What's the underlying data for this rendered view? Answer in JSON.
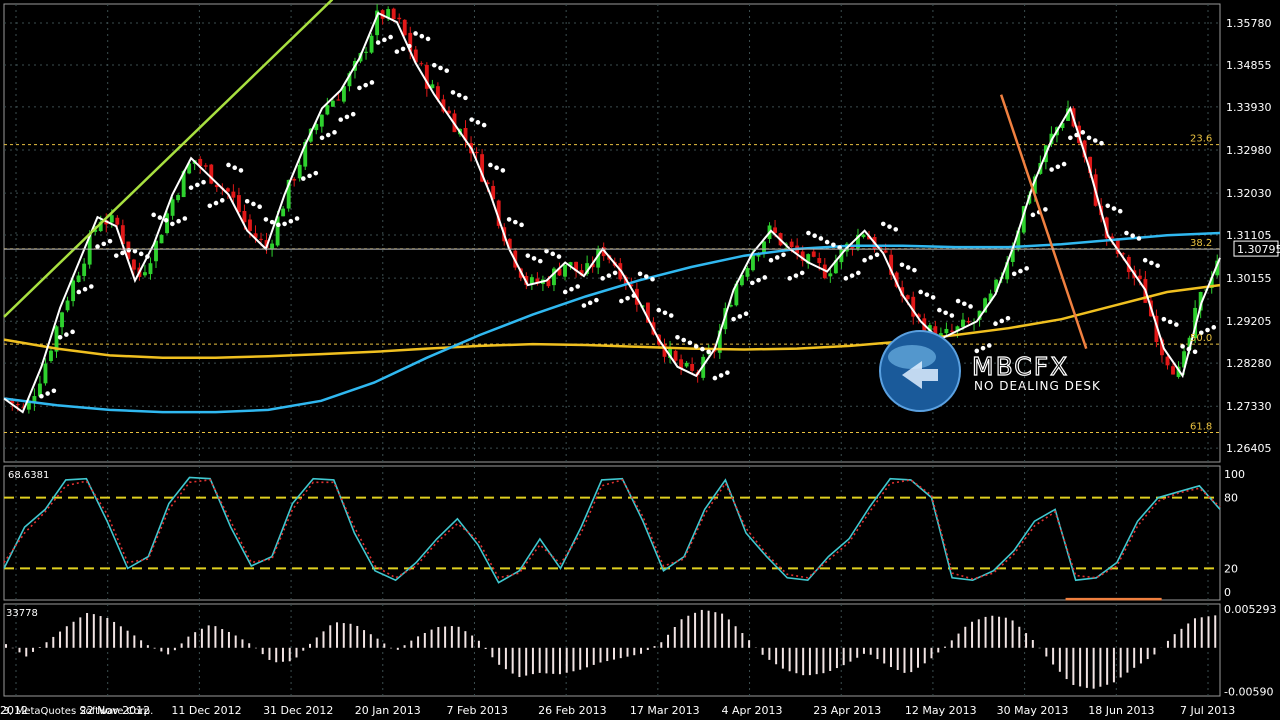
{
  "chart_data": [
    {
      "type": "candlestick",
      "symbol_price_tag": "1.30795",
      "price_ticks": [
        "1.35780",
        "1.34855",
        "1.33930",
        "1.32980",
        "1.32030",
        "1.31105",
        "1.30155",
        "1.29205",
        "1.28280",
        "1.27330",
        "1.26405"
      ],
      "ylim": [
        1.261,
        1.362
      ],
      "x_labels": [
        "2012",
        "22 Nov 2012",
        "11 Dec 2012",
        "31 Dec 2012",
        "20 Jan 2013",
        "7 Feb 2013",
        "26 Feb 2013",
        "17 Mar 2013",
        "4 Apr 2013",
        "23 Apr 2013",
        "12 May 2013",
        "30 May 2013",
        "18 Jun 2013",
        "7 Jul 2013"
      ],
      "close_path": [
        1.275,
        1.272,
        1.282,
        1.295,
        1.305,
        1.315,
        1.313,
        1.301,
        1.309,
        1.32,
        1.328,
        1.324,
        1.32,
        1.312,
        1.308,
        1.32,
        1.33,
        1.339,
        1.343,
        1.35,
        1.36,
        1.358,
        1.349,
        1.342,
        1.336,
        1.33,
        1.32,
        1.308,
        1.3,
        1.301,
        1.305,
        1.302,
        1.308,
        1.303,
        1.296,
        1.288,
        1.282,
        1.28,
        1.286,
        1.299,
        1.307,
        1.312,
        1.308,
        1.305,
        1.303,
        1.308,
        1.312,
        1.307,
        1.298,
        1.292,
        1.288,
        1.29,
        1.292,
        1.298,
        1.309,
        1.322,
        1.332,
        1.339,
        1.326,
        1.311,
        1.305,
        1.299,
        1.286,
        1.28,
        1.296,
        1.306
      ],
      "moving_averages": [
        {
          "name": "slow",
          "color": "#f0c020",
          "values": [
            1.288,
            1.286,
            1.2845,
            1.284,
            1.284,
            1.2843,
            1.2848,
            1.2853,
            1.286,
            1.2866,
            1.287,
            1.2868,
            1.2864,
            1.286,
            1.2858,
            1.286,
            1.2866,
            1.2876,
            1.289,
            1.2905,
            1.2925,
            1.2955,
            1.2985,
            1.3
          ]
        },
        {
          "name": "mid",
          "color": "#30b8f0",
          "values": [
            1.275,
            1.2735,
            1.2725,
            1.272,
            1.272,
            1.2725,
            1.2745,
            1.2785,
            1.284,
            1.289,
            1.2935,
            1.2975,
            1.301,
            1.304,
            1.3065,
            1.308,
            1.3087,
            1.3087,
            1.3084,
            1.3084,
            1.309,
            1.31,
            1.311,
            1.3115
          ]
        }
      ],
      "trend_lines": [
        {
          "color": "#a8e040",
          "from": [
            0,
            1.293
          ],
          "to": [
            0.27,
            1.363
          ]
        },
        {
          "color": "#f08040",
          "from": [
            0.82,
            1.342
          ],
          "to": [
            0.89,
            1.286
          ]
        }
      ],
      "fibonacci": [
        {
          "label": "23.6",
          "price": 1.331
        },
        {
          "label": "38.2",
          "price": 1.308
        },
        {
          "label": "50.0",
          "price": 1.287
        },
        {
          "label": "61.8",
          "price": 1.2675
        }
      ]
    },
    {
      "type": "line",
      "title": "68.6381",
      "ticks": [
        "100",
        "80",
        "20",
        "0"
      ],
      "levels": [
        80,
        20
      ],
      "ylim": [
        0,
        100
      ],
      "series": [
        {
          "color": "#40c8d0",
          "values": [
            20,
            55,
            70,
            95,
            96,
            60,
            20,
            30,
            75,
            97,
            96,
            55,
            22,
            30,
            75,
            96,
            95,
            50,
            18,
            10,
            25,
            45,
            62,
            40,
            8,
            18,
            45,
            20,
            55,
            95,
            96,
            60,
            18,
            30,
            70,
            95,
            50,
            30,
            12,
            10,
            30,
            45,
            72,
            96,
            95,
            80,
            12,
            10,
            18,
            35,
            60,
            70,
            10,
            12,
            25,
            60,
            80,
            85,
            90,
            70
          ]
        },
        {
          "color": "#e03030",
          "dashed": true,
          "values": [
            25,
            50,
            68,
            90,
            94,
            66,
            25,
            28,
            70,
            93,
            95,
            60,
            25,
            28,
            70,
            93,
            93,
            55,
            22,
            12,
            22,
            42,
            58,
            44,
            12,
            16,
            40,
            24,
            50,
            90,
            95,
            64,
            22,
            28,
            66,
            92,
            54,
            32,
            15,
            12,
            27,
            42,
            68,
            92,
            95,
            82,
            16,
            11,
            16,
            32,
            56,
            68,
            14,
            12,
            22,
            56,
            77,
            84,
            88,
            72
          ]
        }
      ]
    },
    {
      "type": "bar",
      "title": "33778",
      "ticks": [
        "0.005293",
        "-0.00590"
      ],
      "ylim": [
        -0.006,
        0.0054
      ],
      "values": [
        0.0005,
        -0.0012,
        0.0008,
        0.003,
        0.0048,
        0.004,
        0.0022,
        0.0002,
        -0.001,
        0.0018,
        0.0032,
        0.002,
        0.0004,
        -0.002,
        -0.0018,
        0.001,
        0.0035,
        0.0032,
        0.0015,
        -0.0005,
        0.0014,
        0.0028,
        0.003,
        0.0012,
        -0.0022,
        -0.004,
        -0.0034,
        -0.0036,
        -0.003,
        -0.002,
        -0.0014,
        -0.0008,
        0.0008,
        0.004,
        0.0052,
        0.0046,
        0.0018,
        -0.0012,
        -0.003,
        -0.0038,
        -0.0034,
        -0.0022,
        -0.0006,
        -0.0024,
        -0.0036,
        -0.0018,
        0.0006,
        0.0034,
        0.0044,
        0.004,
        0.0014,
        -0.002,
        -0.005,
        -0.0056,
        -0.0048,
        -0.0028,
        -0.001,
        0.0018,
        0.004,
        0.0044
      ]
    }
  ],
  "footer_text": "3, MetaQuotes Software Corp.",
  "watermark": {
    "brand": "MBCFX",
    "tagline": "NO DEALING DESK"
  }
}
